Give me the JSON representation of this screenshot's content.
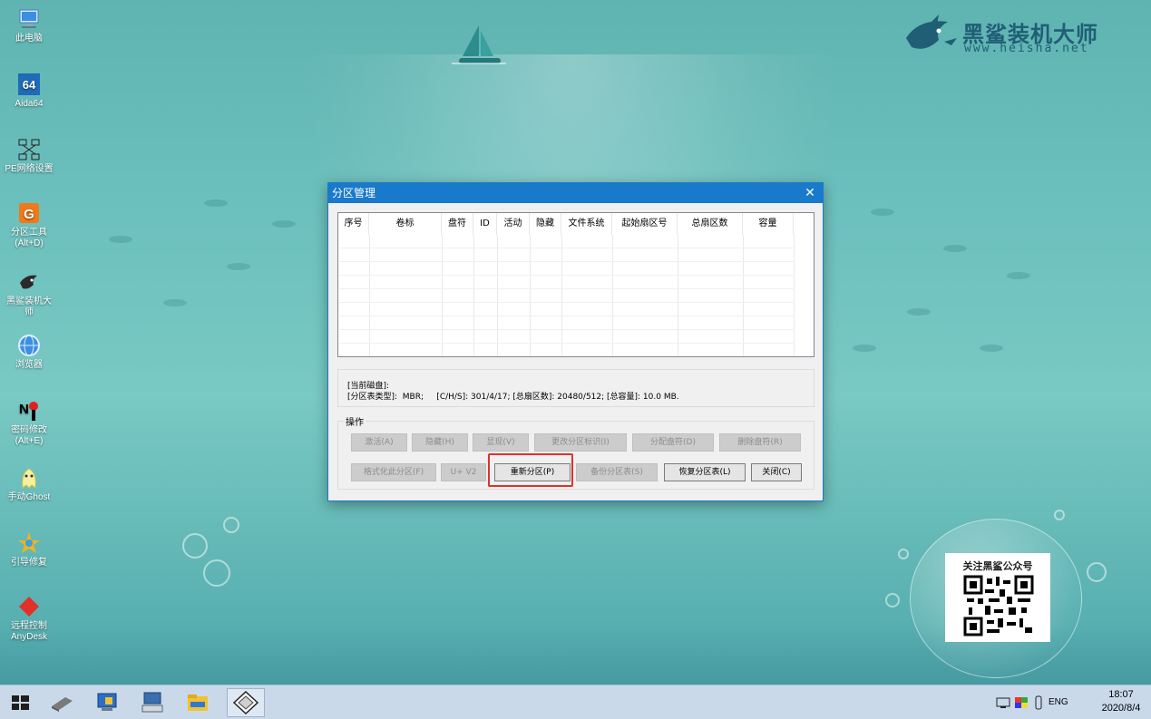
{
  "desktop": {
    "icons": [
      {
        "label": "此电脑",
        "icon": "computer-icon"
      },
      {
        "label": "Aida64",
        "icon": "aida64-icon"
      },
      {
        "label": "PE网络设置",
        "icon": "network-icon"
      },
      {
        "label": "分区工具\n(Alt+D)",
        "icon": "partition-tool-icon"
      },
      {
        "label": "黑鲨装机大\n师",
        "icon": "shark-icon"
      },
      {
        "label": "浏览器",
        "icon": "browser-icon"
      },
      {
        "label": "密码修改\n(Alt+E)",
        "icon": "password-icon"
      },
      {
        "label": "手动Ghost",
        "icon": "ghost-icon"
      },
      {
        "label": "引导修复",
        "icon": "boot-repair-icon"
      },
      {
        "label": "远程控制\nAnyDesk",
        "icon": "anydesk-icon"
      }
    ],
    "brand": {
      "title": "黑鲨装机大师",
      "url": "www.heisha.net"
    },
    "qr": {
      "title": "关注黑鲨公众号"
    }
  },
  "dialog": {
    "title": "分区管理",
    "close_glyph": "✕",
    "columns": [
      "序号",
      "卷标",
      "盘符",
      "ID",
      "活动",
      "隐藏",
      "文件系统",
      "起始扇区号",
      "总扇区数",
      "容量"
    ],
    "info": {
      "line1": "[当前磁盘]:",
      "line2": "[分区表类型]:  MBR;     [C/H/S]: 301/4/17; [总扇区数]: 20480/512; [总容量]: 10.0 MB."
    },
    "ops_legend": "操作",
    "buttons_row1": [
      "激活(A)",
      "隐藏(H)",
      "显现(V)",
      "更改分区标识(I)",
      "分配盘符(D)",
      "删除盘符(R)"
    ],
    "buttons_row2": [
      "格式化此分区(F)",
      "U+ V2",
      "重新分区(P)",
      "备份分区表(S)",
      "恢复分区表(L)",
      "关闭(C)"
    ]
  },
  "taskbar": {
    "lang": "ENG",
    "time": "18:07",
    "date": "2020/8/4",
    "items": [
      "start-icon",
      "drive-icon",
      "pc-icon",
      "keyboard-icon",
      "explorer-icon",
      "partition-app-icon"
    ]
  },
  "colors": {
    "titlebar": "#1979ca",
    "highlight": "#e0312a"
  }
}
